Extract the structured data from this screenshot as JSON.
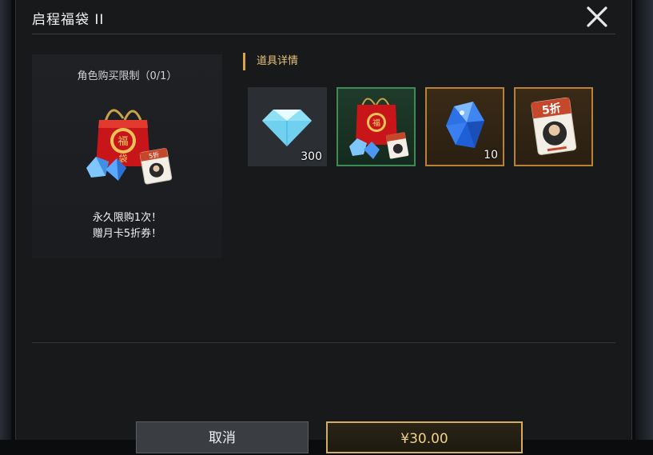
{
  "dialog": {
    "title": "启程福袋 II",
    "close_icon": "close-icon"
  },
  "package": {
    "purchase_limit": "角色购买限制（0/1）",
    "desc_line1": "永久限购1次！",
    "desc_line2": "赠月卡5折券！",
    "icon": "lucky-bag-icon"
  },
  "details": {
    "section_title": "道具详情",
    "items": [
      {
        "icon": "diamond-icon",
        "quantity": "300",
        "frame": "gray"
      },
      {
        "icon": "lucky-bag-icon",
        "quantity": "",
        "frame": "green"
      },
      {
        "icon": "blue-crystal-icon",
        "quantity": "10",
        "frame": "orange"
      },
      {
        "icon": "discount-coupon-icon",
        "quantity": "",
        "frame": "orange",
        "label": "5折"
      }
    ]
  },
  "buttons": {
    "cancel_label": "取消",
    "buy_label": "¥30.00"
  },
  "colors": {
    "accent_gold": "#d9a44a",
    "frame_green": "#3c8a55",
    "frame_orange": "#b8822e",
    "panel_bg": "#18191b"
  }
}
